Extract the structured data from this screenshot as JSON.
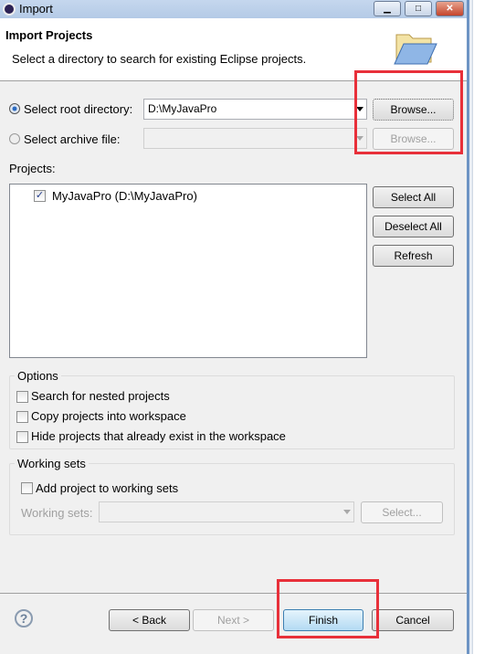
{
  "window": {
    "title": "Import",
    "minimize": "▁",
    "maximize": "□",
    "close": "✕"
  },
  "header": {
    "title": "Import Projects",
    "description": "Select a directory to search for existing Eclipse projects."
  },
  "source": {
    "root_label": "Select root directory:",
    "root_selected": true,
    "root_value": "D:\\MyJavaPro",
    "browse_label": "Browse...",
    "archive_label": "Select archive file:",
    "archive_value": "",
    "archive_browse_label": "Browse..."
  },
  "projects": {
    "label": "Projects:",
    "items": [
      {
        "label": "MyJavaPro (D:\\MyJavaPro)",
        "checked": true
      }
    ],
    "select_all": "Select All",
    "deselect_all": "Deselect All",
    "refresh": "Refresh"
  },
  "options": {
    "legend": "Options",
    "items": [
      {
        "label": "Search for nested projects",
        "checked": false
      },
      {
        "label": "Copy projects into workspace",
        "checked": false
      },
      {
        "label": "Hide projects that already exist in the workspace",
        "checked": false
      }
    ]
  },
  "working_sets": {
    "legend": "Working sets",
    "add_label": "Add project to working sets",
    "add_checked": false,
    "sets_label": "Working sets:",
    "sets_value": "",
    "select_label": "Select..."
  },
  "footer": {
    "help": "?",
    "back": "< Back",
    "next": "Next >",
    "finish": "Finish",
    "cancel": "Cancel"
  },
  "colors": {
    "highlight": "#e8303a"
  }
}
